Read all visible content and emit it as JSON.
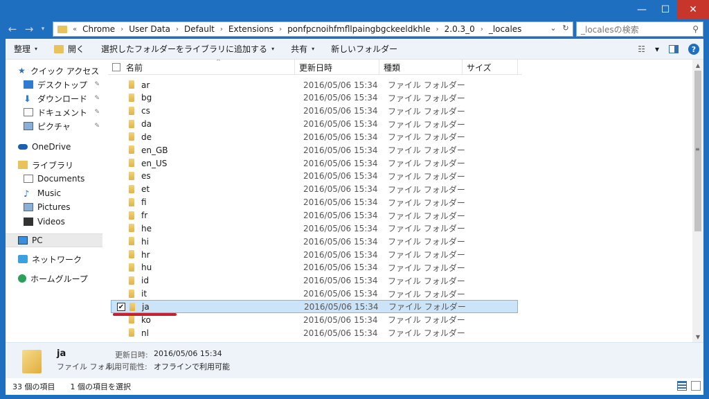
{
  "window": {
    "min_glyph": "—",
    "max_glyph": "☐",
    "close_glyph": "✕"
  },
  "address": {
    "back_glyph": "←",
    "forward_glyph": "→",
    "down_glyph": "▾",
    "up_glyph": "↑",
    "overflow": "«",
    "crumbs": [
      "Chrome",
      "User Data",
      "Default",
      "Extensions",
      "ponfpcnoihfmfllpaingbgckeeldkhle",
      "2.0.3_0",
      "_locales"
    ],
    "separator": "›",
    "dropdown_glyph": "⌄",
    "refresh_glyph": "↻"
  },
  "search": {
    "placeholder": "_localesの検索",
    "icon_glyph": "⚲"
  },
  "toolbar": {
    "organize": "整理",
    "open": "開く",
    "add_to_library": "選択したフォルダーをライブラリに追加する",
    "share": "共有",
    "new_folder": "新しいフォルダー",
    "caret": "▾",
    "view_glyph": "☷",
    "help_glyph": "?"
  },
  "nav": {
    "quick_access": "クイック アクセス",
    "desktop": "デスクトップ",
    "downloads": "ダウンロード",
    "documents_jp": "ドキュメント",
    "pictures_jp": "ピクチャ",
    "onedrive": "OneDrive",
    "library": "ライブラリ",
    "documents": "Documents",
    "music": "Music",
    "pictures": "Pictures",
    "videos": "Videos",
    "pc": "PC",
    "network": "ネットワーク",
    "homegroup": "ホームグループ",
    "pin_glyph": "✎",
    "star_glyph": "★",
    "download_glyph": "⬇",
    "music_glyph": "♪"
  },
  "columns": {
    "name": "名前",
    "date": "更新日時",
    "type": "種類",
    "size": "サイズ",
    "sort_glyph": "^"
  },
  "files": [
    {
      "name": "ar",
      "date": "2016/05/06 15:34",
      "type": "ファイル フォルダー"
    },
    {
      "name": "bg",
      "date": "2016/05/06 15:34",
      "type": "ファイル フォルダー"
    },
    {
      "name": "cs",
      "date": "2016/05/06 15:34",
      "type": "ファイル フォルダー"
    },
    {
      "name": "da",
      "date": "2016/05/06 15:34",
      "type": "ファイル フォルダー"
    },
    {
      "name": "de",
      "date": "2016/05/06 15:34",
      "type": "ファイル フォルダー"
    },
    {
      "name": "en_GB",
      "date": "2016/05/06 15:34",
      "type": "ファイル フォルダー"
    },
    {
      "name": "en_US",
      "date": "2016/05/06 15:34",
      "type": "ファイル フォルダー"
    },
    {
      "name": "es",
      "date": "2016/05/06 15:34",
      "type": "ファイル フォルダー"
    },
    {
      "name": "et",
      "date": "2016/05/06 15:34",
      "type": "ファイル フォルダー"
    },
    {
      "name": "fi",
      "date": "2016/05/06 15:34",
      "type": "ファイル フォルダー"
    },
    {
      "name": "fr",
      "date": "2016/05/06 15:34",
      "type": "ファイル フォルダー"
    },
    {
      "name": "he",
      "date": "2016/05/06 15:34",
      "type": "ファイル フォルダー"
    },
    {
      "name": "hi",
      "date": "2016/05/06 15:34",
      "type": "ファイル フォルダー"
    },
    {
      "name": "hr",
      "date": "2016/05/06 15:34",
      "type": "ファイル フォルダー"
    },
    {
      "name": "hu",
      "date": "2016/05/06 15:34",
      "type": "ファイル フォルダー"
    },
    {
      "name": "id",
      "date": "2016/05/06 15:34",
      "type": "ファイル フォルダー"
    },
    {
      "name": "it",
      "date": "2016/05/06 15:34",
      "type": "ファイル フォルダー"
    },
    {
      "name": "ja",
      "date": "2016/05/06 15:34",
      "type": "ファイル フォルダー",
      "selected": true
    },
    {
      "name": "ko",
      "date": "2016/05/06 15:34",
      "type": "ファイル フォルダー"
    },
    {
      "name": "nl",
      "date": "2016/05/06 15:34",
      "type": "ファイル フォルダー"
    }
  ],
  "check_glyph": "✔",
  "scroll": {
    "up_glyph": "▲",
    "down_glyph": "▼",
    "grip_glyph": "≡"
  },
  "details": {
    "name": "ja",
    "type": "ファイル フォル...",
    "modified_label": "更新日時:",
    "modified_value": "2016/05/06 15:34",
    "availability_label": "利用可能性:",
    "availability_value": "オフラインで利用可能"
  },
  "status": {
    "count": "33 個の項目",
    "selected": "1 個の項目を選択"
  },
  "colors": {
    "titlebar": "#1e6fc0",
    "selection": "#cce4f7",
    "close": "#c7352b",
    "annotation": "#c8202e"
  }
}
